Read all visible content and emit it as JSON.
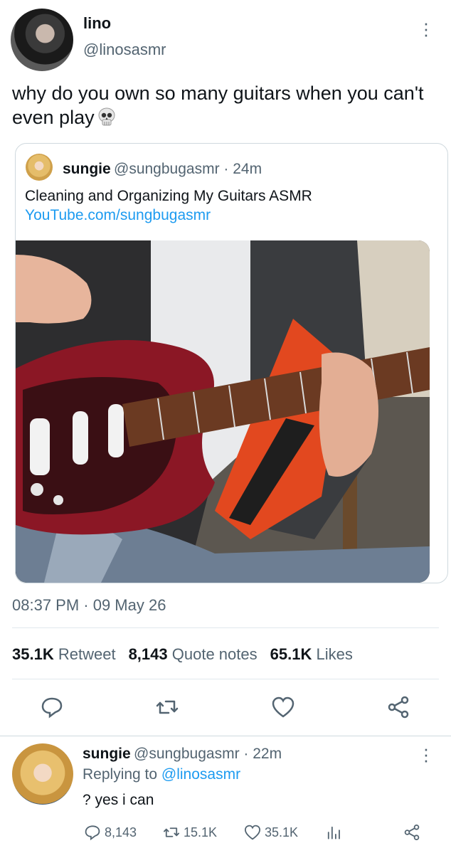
{
  "tweet": {
    "author_name": "lino",
    "author_handle": "@linosasmr",
    "text": "why do you own so many guitars when you can't even play",
    "emoji": "skull",
    "timestamp": "08:37 PM · 09 May 26"
  },
  "quote": {
    "name": "sungie",
    "meta": "@sungbugasmr · 24m",
    "line1": "Cleaning and Organizing My Guitars ASMR",
    "link": "YouTube.com/sungbugasmr",
    "media_description_icon": "guitar-photo"
  },
  "stats": {
    "retweets_count": "35.1K",
    "retweets_label": "Retweet",
    "quotes_count": "8,143",
    "quotes_label": "Quote notes",
    "likes_count": "65.1K",
    "likes_label": "Likes"
  },
  "actions": [
    "reply-icon",
    "retweet-icon",
    "like-icon",
    "share-icon"
  ],
  "reply": {
    "name": "sungie",
    "meta": "@sungbugasmr · 22m",
    "replying_prefix": "Replying to",
    "replying_to": "@linosasmr",
    "text": "? yes i can",
    "reply_count": "8,143",
    "retweet_count": "15.1K",
    "like_count": "35.1K"
  },
  "colors": {
    "accent": "#1d9bf0",
    "secondary_text": "#536471",
    "primary_text": "#0f1419",
    "border": "#cfd9de"
  }
}
